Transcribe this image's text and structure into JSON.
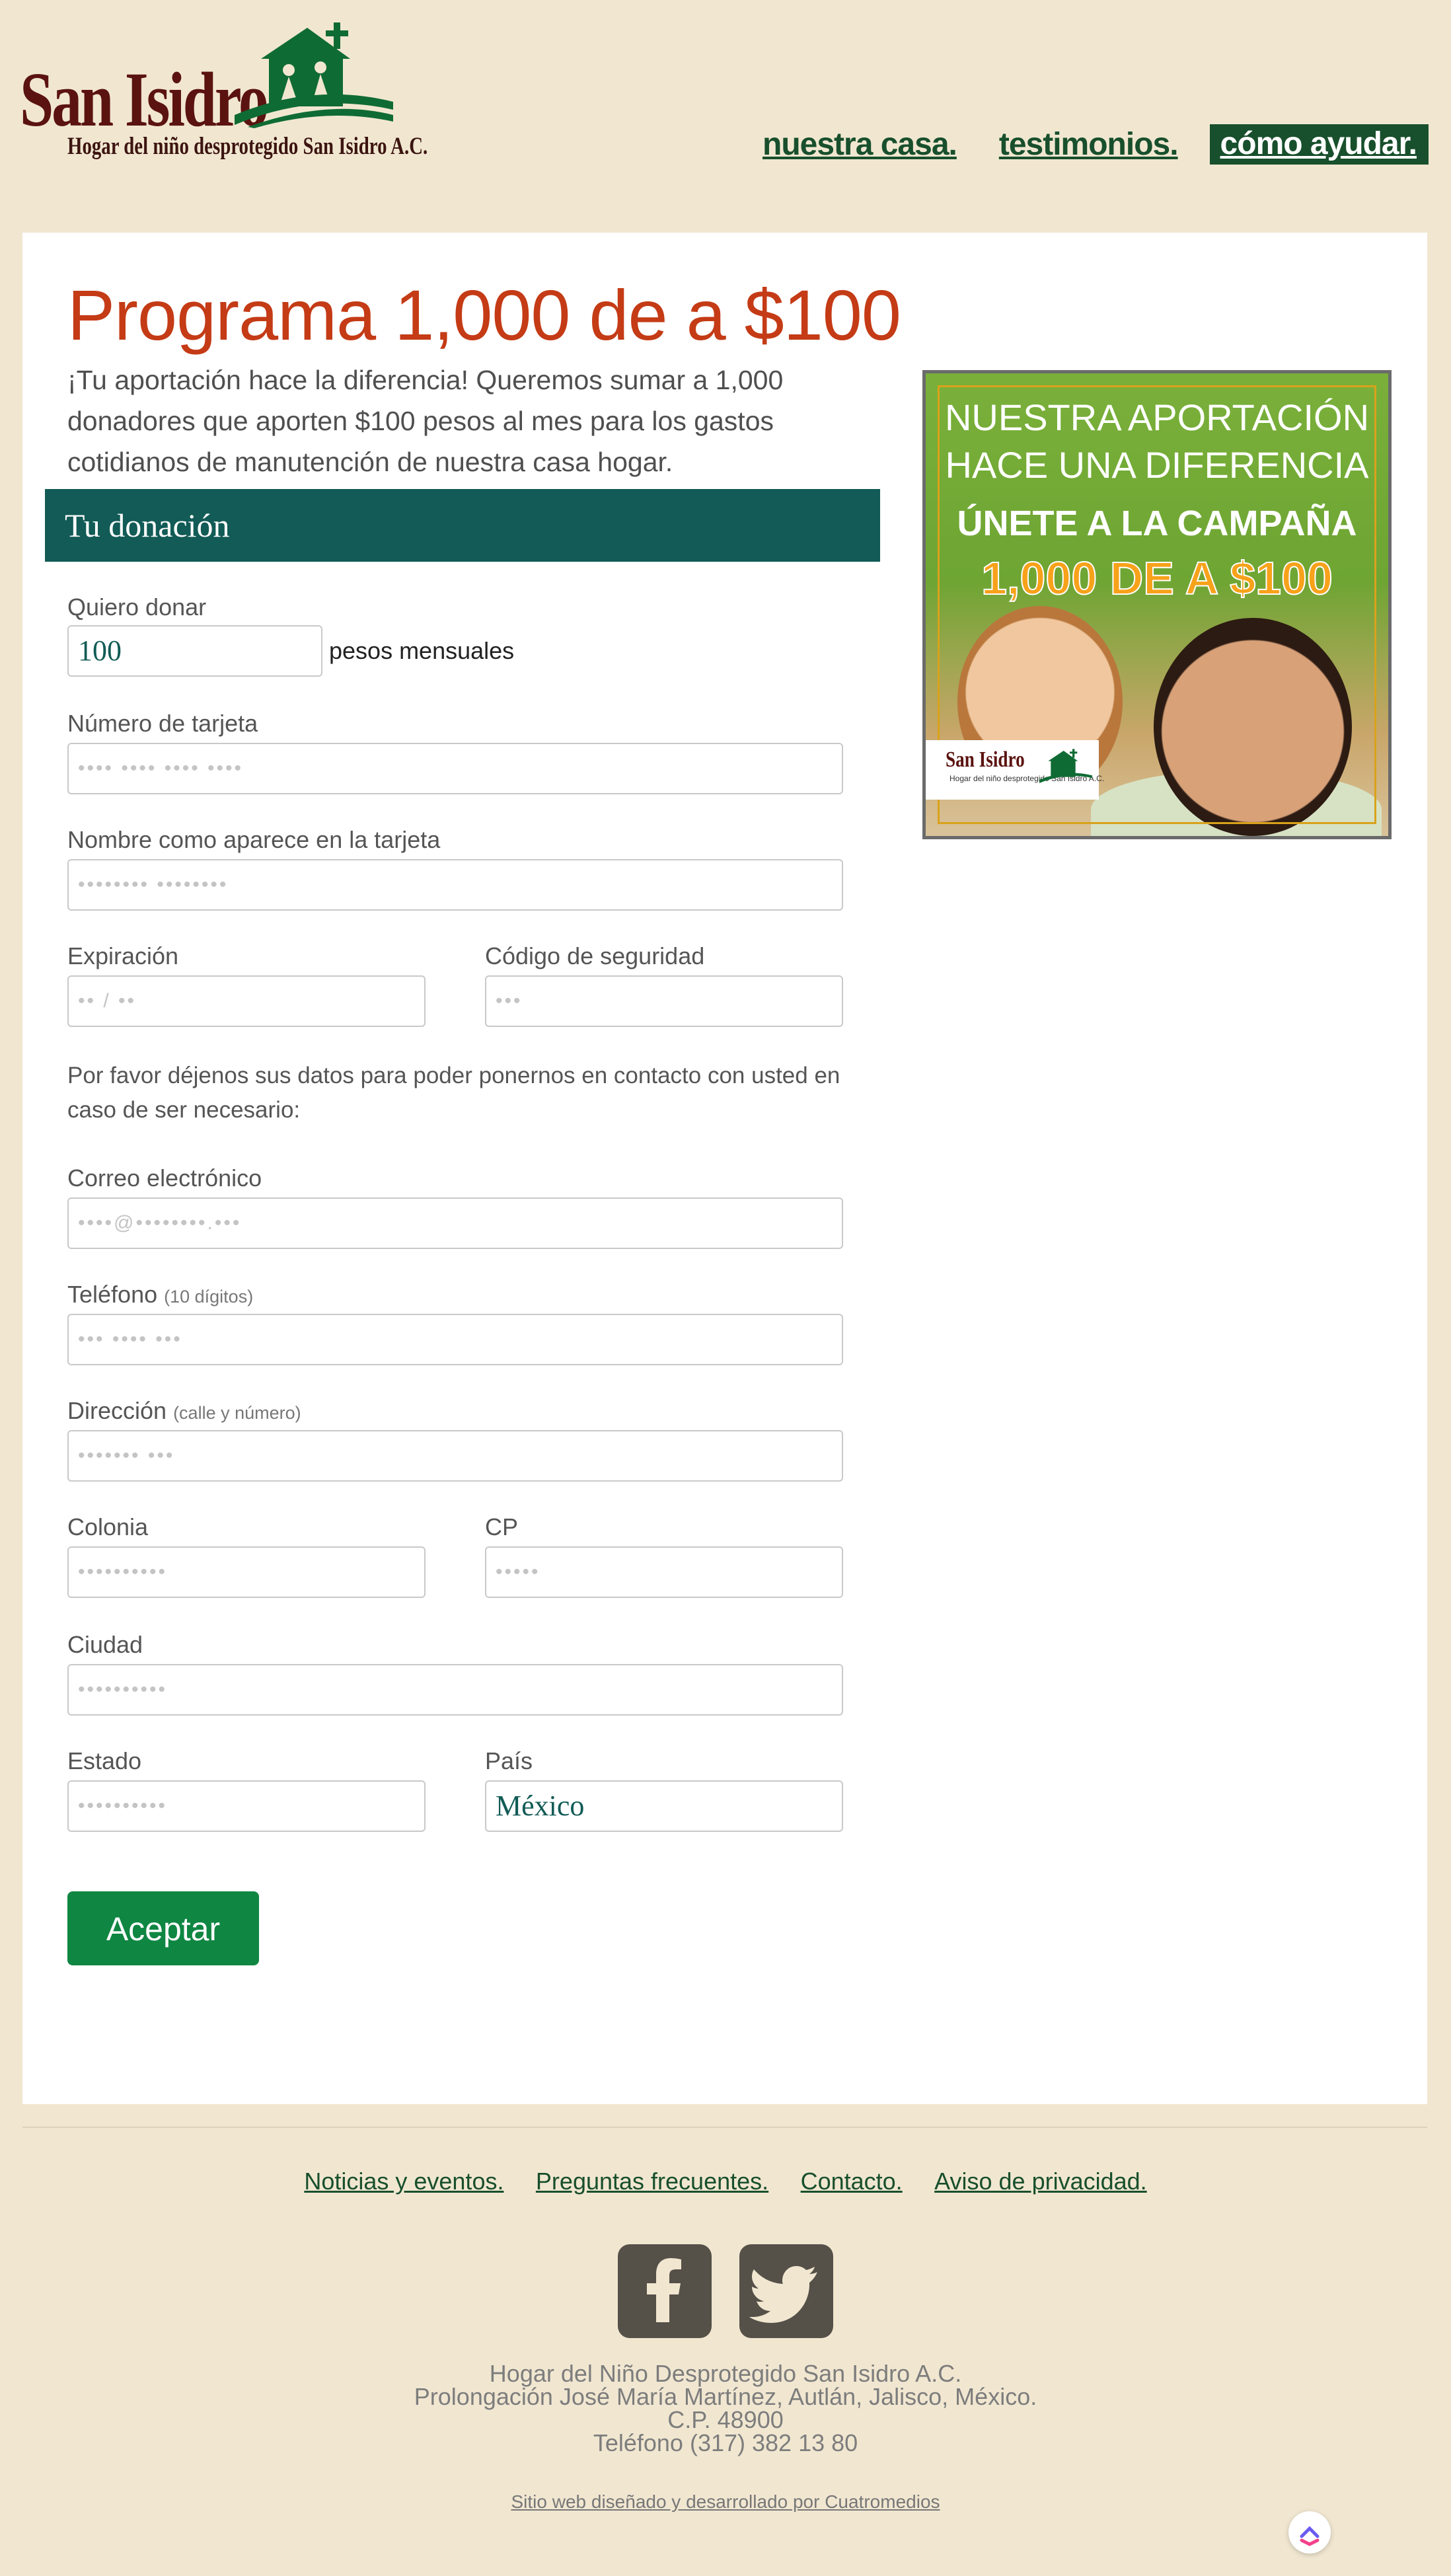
{
  "header": {
    "logo": {
      "title": "San Isidro",
      "subtitle": "Hogar del niño desprotegido San Isidro A.C."
    },
    "nav": [
      "nuestra casa.",
      "testimonios.",
      "cómo ayudar."
    ],
    "nav_active_index": 2
  },
  "main": {
    "title": "Programa 1,000 de a $100",
    "intro": "¡Tu aportación hace la diferencia! Queremos sumar a 1,000 donadores que aporten $100 pesos al mes para los gastos cotidianos de manutención de nuestra casa hogar.",
    "section_title": "Tu donación",
    "form": {
      "amount": {
        "label": "Quiero donar",
        "value": "100",
        "suffix": "pesos mensuales"
      },
      "card_number": {
        "label": "Número de tarjeta",
        "placeholder": "•••• •••• •••• ••••"
      },
      "card_name": {
        "label": "Nombre como aparece en la tarjeta",
        "placeholder": "•••••••• ••••••••"
      },
      "expiry": {
        "label": "Expiración",
        "placeholder": "•• / ••"
      },
      "cvc": {
        "label": "Código de seguridad",
        "placeholder": "•••"
      },
      "contact_note": "Por favor déjenos sus datos para poder ponernos en contacto con usted en caso de ser necesario:",
      "email": {
        "label": "Correo electrónico",
        "placeholder": "••••@••••••••.•••"
      },
      "phone": {
        "label": "Teléfono",
        "hint": "(10 dígitos)",
        "placeholder": "••• •••• •••"
      },
      "address": {
        "label": "Dirección",
        "hint": "(calle y número)",
        "placeholder": "••••••• •••"
      },
      "colonia": {
        "label": "Colonia",
        "placeholder": "••••••••••"
      },
      "cp": {
        "label": "CP",
        "placeholder": "•••••"
      },
      "city": {
        "label": "Ciudad",
        "placeholder": "••••••••••"
      },
      "state": {
        "label": "Estado",
        "placeholder": "••••••••••"
      },
      "country": {
        "label": "País",
        "value": "México"
      },
      "submit": "Aceptar"
    },
    "ad": {
      "line1": "NUESTRA APORTACIÓN",
      "line2": "HACE UNA DIFERENCIA",
      "line3": "ÚNETE A LA CAMPAÑA",
      "line4": "1,000 DE A $100",
      "logo_title": "San Isidro",
      "logo_subtitle": "Hogar del niño desprotegido San Isidro A.C."
    }
  },
  "footer": {
    "links": [
      "Noticias y eventos.",
      "Preguntas frecuentes.",
      "Contacto.",
      "Aviso de privacidad."
    ],
    "social": [
      "facebook-icon",
      "twitter-icon"
    ],
    "address": [
      "Hogar del Niño Desprotegido San Isidro A.C.",
      "Prolongación José María Martínez, Autlán, Jalisco, México.",
      "C.P. 48900",
      "Teléfono (317) 382 13 80"
    ],
    "credit": "Sitio web diseñado y desarrollado por Cuatromedios"
  },
  "colors": {
    "background": "#f1e7d1",
    "brand_green": "#184f2c",
    "title_orange": "#c43b16",
    "section_teal": "#125b56",
    "button_green": "#0f8642"
  }
}
